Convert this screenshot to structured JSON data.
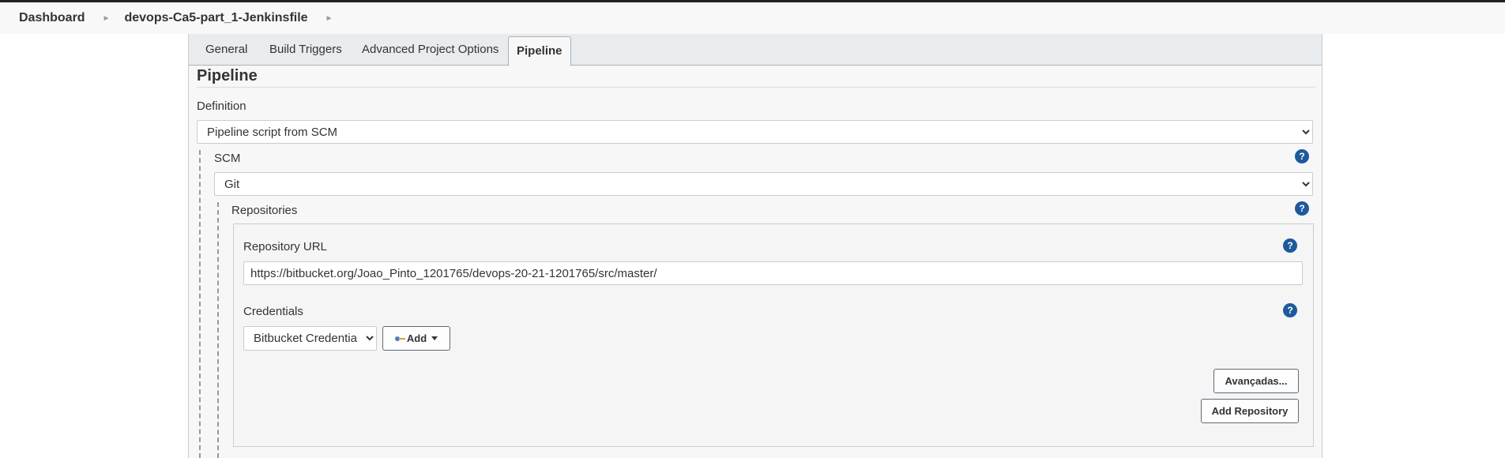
{
  "breadcrumb": {
    "items": [
      {
        "label": "Dashboard"
      },
      {
        "label": "devops-Ca5-part_1-Jenkinsfile"
      }
    ]
  },
  "tabs": [
    {
      "label": "General",
      "active": false
    },
    {
      "label": "Build Triggers",
      "active": false
    },
    {
      "label": "Advanced Project Options",
      "active": false
    },
    {
      "label": "Pipeline",
      "active": true
    }
  ],
  "pipeline": {
    "section_title": "Pipeline",
    "definition_label": "Definition",
    "definition_value": "Pipeline script from SCM",
    "scm_label": "SCM",
    "scm_value": "Git",
    "repositories_label": "Repositories",
    "repository_url_label": "Repository URL",
    "repository_url_value": "https://bitbucket.org/Joao_Pinto_1201765/devops-20-21-1201765/src/master/",
    "credentials_label": "Credentials",
    "credentials_value": "Bitbucket Credentials",
    "add_label": "Add",
    "advanced_label": "Avançadas...",
    "add_repository_label": "Add Repository",
    "help_glyph": "?"
  },
  "colors": {
    "help_icon": "#1d5a9c",
    "tab_bar": "#e8ecef",
    "panel": "#f7f7f7"
  },
  "icons": [
    "chevron-right-icon",
    "help-icon",
    "key-icon",
    "caret-down-icon"
  ]
}
